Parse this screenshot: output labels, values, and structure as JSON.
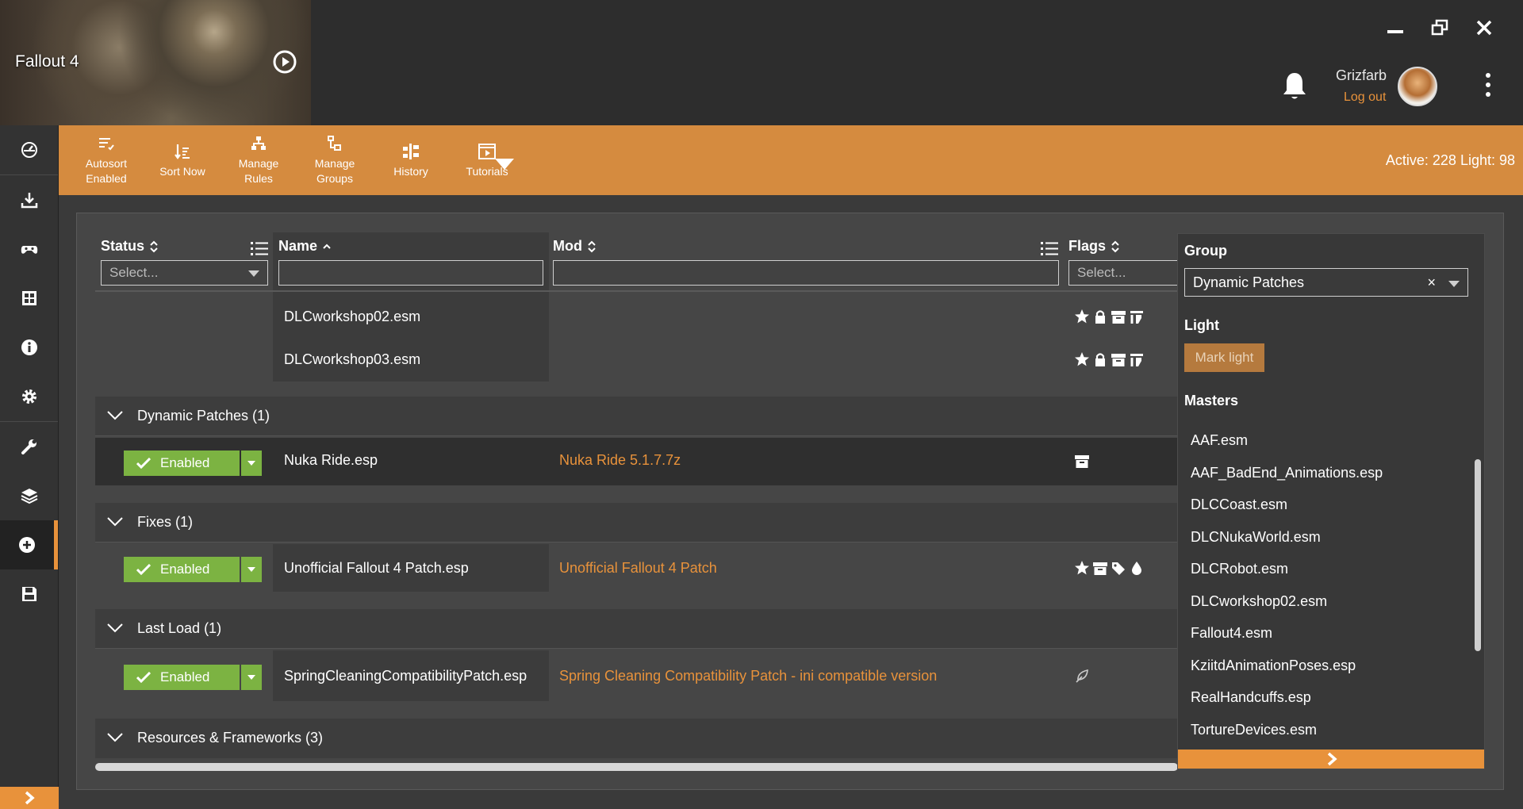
{
  "window": {
    "game_title": "Fallout 4",
    "icons": [
      "play-icon",
      "minimize-icon",
      "restore-icon",
      "close-icon"
    ]
  },
  "user": {
    "name": "Grizfarb",
    "logout_label": "Log out"
  },
  "toolbar": {
    "autosort": "Autosort",
    "autosort_state": "Enabled",
    "sort_now": "Sort Now",
    "manage_rules_1": "Manage",
    "manage_rules_2": "Rules",
    "manage_groups_1": "Manage",
    "manage_groups_2": "Groups",
    "history": "History",
    "tutorials": "Tutorials",
    "active_count": "Active: 228 Light: 98"
  },
  "sidebar": {
    "items": [
      "dashboard-icon",
      "download-icon",
      "gamepad-icon",
      "mods-icon",
      "info-icon",
      "settings-icon",
      "wrench-icon",
      "layers-icon",
      "plugins-icon",
      "save-icon"
    ],
    "accent": "#e8923b"
  },
  "table": {
    "columns": {
      "status": "Status",
      "name": "Name",
      "mod": "Mod",
      "flags": "Flags"
    },
    "status_filter_placeholder": "Select...",
    "flags_filter_placeholder": "Select...",
    "name_filter_value": "",
    "mod_filter_value": "",
    "plain_rows": [
      {
        "name": "DLCworkshop02.esm"
      },
      {
        "name": "DLCworkshop03.esm"
      }
    ],
    "groups": [
      {
        "label": "Dynamic Patches (1)"
      },
      {
        "label": "Fixes (1)"
      },
      {
        "label": "Last Load (1)"
      },
      {
        "label": "Resources & Frameworks (3)"
      }
    ],
    "plugins": [
      {
        "status": "Enabled",
        "name": "Nuka Ride.esp",
        "mod": "Nuka Ride 5.1.7.7z"
      },
      {
        "status": "Enabled",
        "name": "Unofficial Fallout 4 Patch.esp",
        "mod": "Unofficial Fallout 4 Patch"
      },
      {
        "status": "Enabled",
        "name": "SpringCleaningCompatibilityPatch.esp",
        "mod": "Spring Cleaning Compatibility Patch - ini compatible version"
      }
    ],
    "enabled_color": "#7cb342"
  },
  "group_panel": {
    "group_label": "Group",
    "group_value": "Dynamic Patches",
    "clear_symbol": "×",
    "light_label": "Light",
    "mark_light_label": "Mark light",
    "masters_label": "Masters",
    "masters": [
      "AAF.esm",
      "AAF_BadEnd_Animations.esp",
      "DLCCoast.esm",
      "DLCNukaWorld.esm",
      "DLCRobot.esm",
      "DLCworkshop02.esm",
      "Fallout4.esm",
      "KziitdAnimationPoses.esp",
      "RealHandcuffs.esp",
      "TortureDevices.esm"
    ]
  }
}
